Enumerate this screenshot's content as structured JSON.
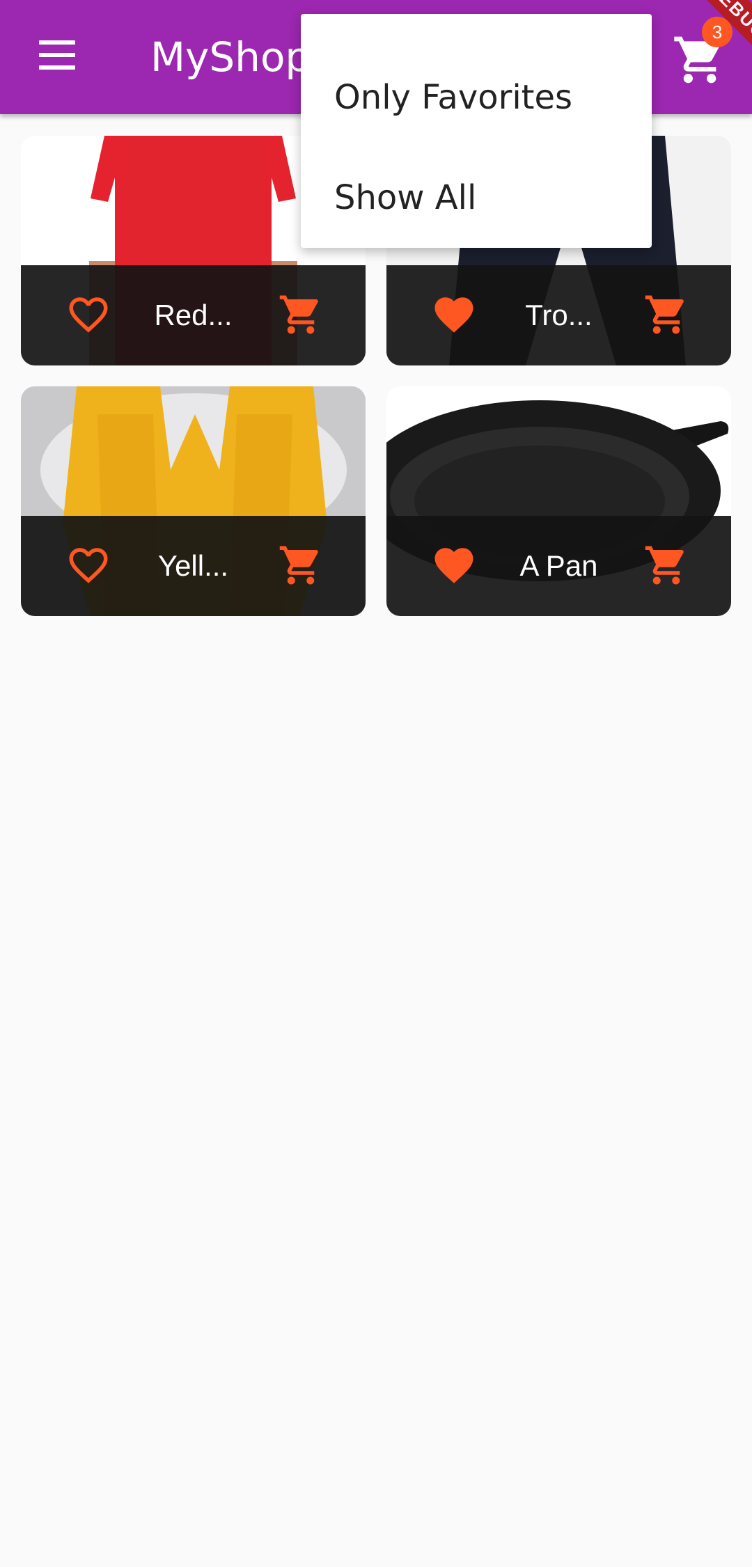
{
  "app_bar": {
    "title": "MyShop",
    "menu_icon": "hamburger-menu-icon",
    "cart_icon": "shopping-cart-icon",
    "cart_count": "3",
    "debug_banner": "DEBUG"
  },
  "filter_menu": {
    "items": [
      {
        "label": "Only Favorites"
      },
      {
        "label": "Show All"
      }
    ]
  },
  "products": [
    {
      "name": "Red...",
      "favorite": false,
      "image": "red-shirt"
    },
    {
      "name": "Tro...",
      "favorite": true,
      "image": "trousers"
    },
    {
      "name": "Yell...",
      "favorite": false,
      "image": "yellow-scarf"
    },
    {
      "name": "A Pan",
      "favorite": true,
      "image": "pan"
    }
  ],
  "colors": {
    "primary": "#9c27b0",
    "accent": "#ff5722",
    "tile_footer": "#141414",
    "background": "#fafafa"
  }
}
